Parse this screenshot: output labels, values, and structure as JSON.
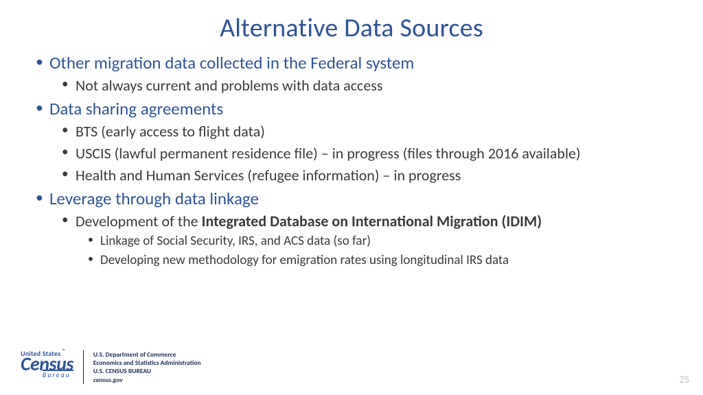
{
  "title": "Alternative Data Sources",
  "bullets": {
    "b1": "Other migration data collected in the Federal system",
    "b1a": "Not always current and problems with data access",
    "b2": "Data sharing agreements",
    "b2a": "BTS (early access to flight data)",
    "b2b": "USCIS (lawful permanent residence file) – in progress (files through 2016 available)",
    "b2c": "Health and Human Services (refugee information) – in progress",
    "b3": "Leverage through data linkage",
    "b3a_pre": "Development of the ",
    "b3a_bold": "Integrated Database on International Migration (IDIM)",
    "b3a1": "Linkage of Social Security, IRS, and ACS data (so far)",
    "b3a2": "Developing new methodology for emigration rates using longitudinal IRS data"
  },
  "footer": {
    "logo_top": "United States",
    "tm": "™",
    "logo_main": "Census",
    "logo_sub": "Bureau",
    "dept1": "U.S. Department of Commerce",
    "dept2": "Economics and Statistics Administration",
    "dept3": "U.S. CENSUS BUREAU",
    "url": "census.gov"
  },
  "page": "25"
}
